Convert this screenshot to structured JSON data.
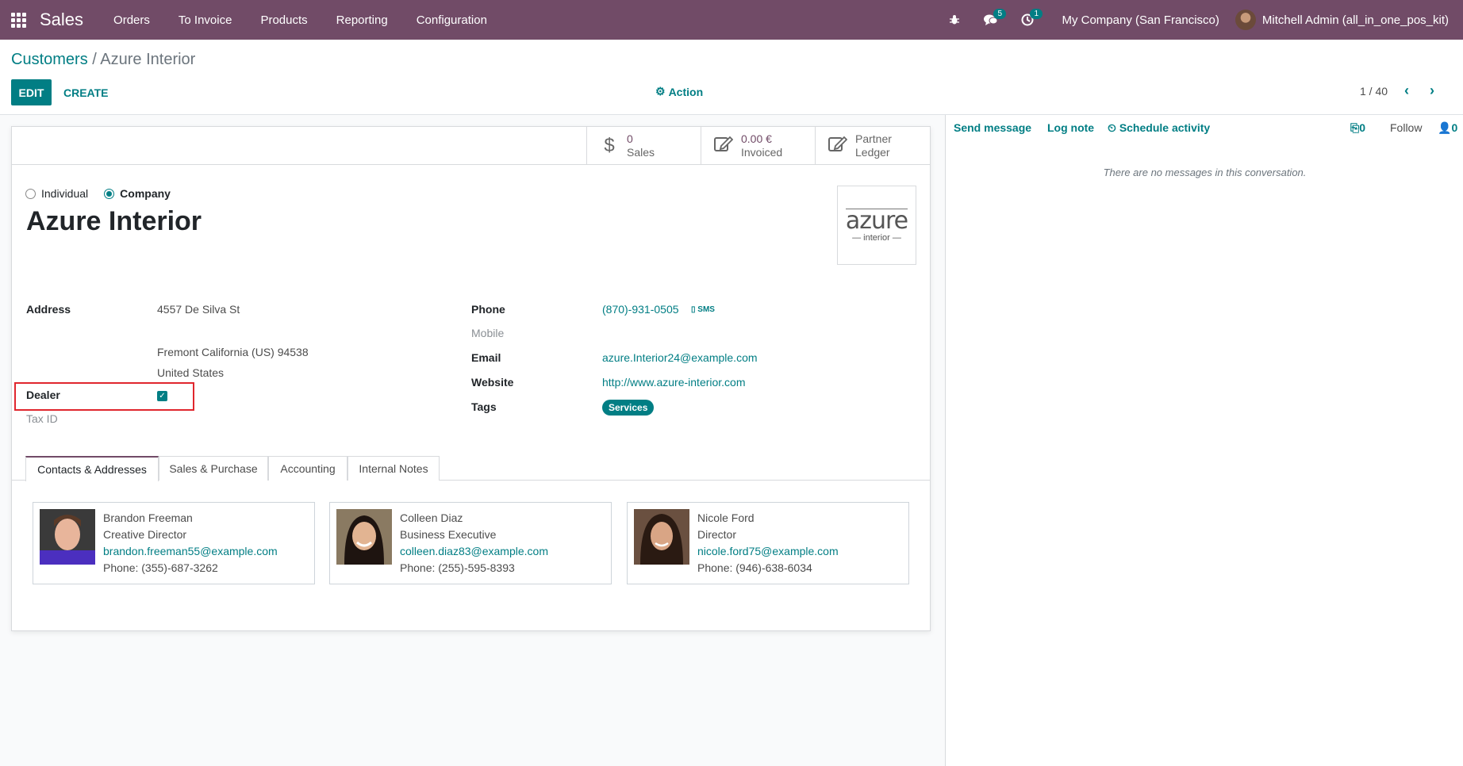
{
  "navbar": {
    "app_name": "Sales",
    "menu": [
      "Orders",
      "To Invoice",
      "Products",
      "Reporting",
      "Configuration"
    ],
    "messages_count": "5",
    "activities_count": "1",
    "company": "My Company (San Francisco)",
    "user": "Mitchell Admin (all_in_one_pos_kit)",
    "brand_color": "#714b67"
  },
  "control": {
    "breadcrumb_parent": "Customers",
    "breadcrumb_sep": "/",
    "breadcrumb_current": "Azure Interior",
    "edit_label": "EDIT",
    "create_label": "CREATE",
    "action_label": "Action",
    "pager": "1 / 40",
    "accent_color": "#017e84"
  },
  "stats": {
    "sales_value": "0",
    "sales_label": "Sales",
    "invoiced_value": "0.00 €",
    "invoiced_label": "Invoiced",
    "ledger_line1": "Partner",
    "ledger_line2": "Ledger"
  },
  "form": {
    "type_individual": "Individual",
    "type_company": "Company",
    "name": "Azure Interior",
    "logo_top": "azure",
    "logo_bottom": "— interior —",
    "address_label": "Address",
    "street": "4557 De Silva St",
    "city_line": "Fremont  California (US)  94538",
    "country": "United States",
    "dealer_label": "Dealer",
    "dealer_checked": true,
    "taxid_label": "Tax ID",
    "phone_label": "Phone",
    "phone_value": "(870)-931-0505",
    "sms_label": "SMS",
    "mobile_label": "Mobile",
    "email_label": "Email",
    "email_value": "azure.Interior24@example.com",
    "website_label": "Website",
    "website_value": "http://www.azure-interior.com",
    "tags_label": "Tags",
    "tag": "Services"
  },
  "tabs": [
    "Contacts & Addresses",
    "Sales & Purchase",
    "Accounting",
    "Internal Notes"
  ],
  "contacts": [
    {
      "name": "Brandon Freeman",
      "title": "Creative Director",
      "email": "brandon.freeman55@example.com",
      "phone": "Phone: (355)-687-3262"
    },
    {
      "name": "Colleen Diaz",
      "title": "Business Executive",
      "email": "colleen.diaz83@example.com",
      "phone": "Phone: (255)-595-8393"
    },
    {
      "name": "Nicole Ford",
      "title": "Director",
      "email": "nicole.ford75@example.com",
      "phone": "Phone: (946)-638-6034"
    }
  ],
  "chatter": {
    "send_message": "Send message",
    "log_note": "Log note",
    "schedule_activity": "Schedule activity",
    "attachments": "0",
    "follow": "Follow",
    "followers": "0",
    "empty_text": "There are no messages in this conversation."
  }
}
